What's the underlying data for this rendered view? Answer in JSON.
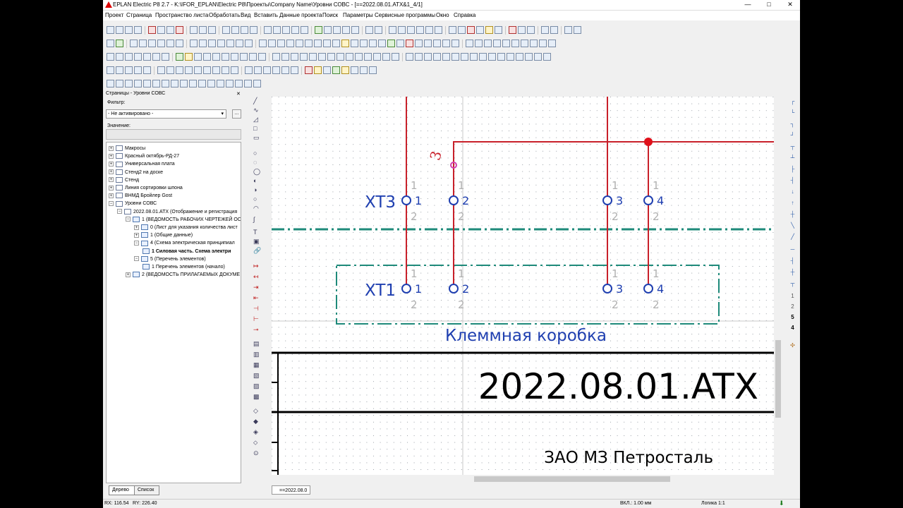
{
  "window": {
    "title": "EPLAN Electric P8 2.7 - K:\\IFOR_EPLAN\\Electric P8\\Проекты\\Company Name\\Уровни СОВС - [==2022.08.01.ATX&1_4/1]",
    "minimize": "—",
    "maximize": "□",
    "close": "✕"
  },
  "menu": [
    "Проект",
    "Страница",
    "Пространство листа",
    "Обработать",
    "Вид",
    "Вставить",
    "Данные проекта",
    "Поиск",
    "Параметры",
    "Сервисные программы",
    "Окно",
    "Справка"
  ],
  "left_panel": {
    "header": "Страницы - Уровни СОВС",
    "close": "✕",
    "filter_label": "Фильтр:",
    "filter_value": "- Не активировано -",
    "filter_button": "...",
    "value_label": "Значение:",
    "tree": [
      {
        "label": "Макросы",
        "level": 0,
        "expander": "+"
      },
      {
        "label": "Красный октябрь-РД-27",
        "level": 0,
        "expander": "+"
      },
      {
        "label": "Универсальная плата",
        "level": 0,
        "expander": "+"
      },
      {
        "label": "Стенд2 на доске",
        "level": 0,
        "expander": "+"
      },
      {
        "label": "Стенд",
        "level": 0,
        "expander": "+"
      },
      {
        "label": "Линия сортировки шпона",
        "level": 0,
        "expander": "+"
      },
      {
        "label": "ВНМД Бройлер Gost",
        "level": 0,
        "expander": "+"
      },
      {
        "label": "Уровни СОВС",
        "level": 0,
        "expander": "−"
      },
      {
        "label": "2022.08.01.ATX (Отображение и регистрация",
        "level": 1,
        "expander": "−"
      },
      {
        "label": "1 (ВЕДОМОСТЬ РАБОЧИХ ЧЕРТЕЖЕЙ ОС",
        "level": 2,
        "expander": "−"
      },
      {
        "label": "0 (Лист для указания количества лист",
        "level": 3,
        "expander": "+"
      },
      {
        "label": "1 (Общие данные)",
        "level": 3,
        "expander": "+"
      },
      {
        "label": "4 (Схема электрическая  принципиал",
        "level": 3,
        "expander": "−"
      },
      {
        "label": "1 Силовая часть. Схема электри",
        "level": 4,
        "expander": "",
        "selected": true
      },
      {
        "label": "5 (Перечень элементов)",
        "level": 3,
        "expander": "−"
      },
      {
        "label": "1 Перечень элементов (начало)",
        "level": 4,
        "expander": ""
      },
      {
        "label": "2 (ВЕДОМОСТЬ ПРИЛАГАЕМЫХ ДОКУМЕ",
        "level": 2,
        "expander": "+"
      }
    ],
    "tabs": [
      "Дерево",
      "Список"
    ]
  },
  "page_tab": "==2022.08.0",
  "right_numbers": [
    "1",
    "2",
    "5",
    "4"
  ],
  "schematic": {
    "wire_number": "3",
    "terminal_strips": [
      {
        "name": "XT3",
        "pins": [
          "1",
          "2",
          "3",
          "4"
        ]
      },
      {
        "name": "XT1",
        "pins": [
          "1",
          "2",
          "3",
          "4"
        ]
      }
    ],
    "upper_pin": "1",
    "lower_pin": "2",
    "box_label": "Клеммная коробка",
    "drawing_number": "2022.08.01.ATX",
    "company": "ЗАО МЗ Петросталь",
    "colors": {
      "wire": "#c8202a",
      "box": "#1e8a7a",
      "text": "#1f3fb0",
      "junction": "#e0101a",
      "pink": "#d040b0",
      "grey": "#b0b0b0"
    }
  },
  "status": {
    "rx": "RX: 116.54",
    "ry": "RY: 226.40",
    "grid": "ВКЛ.: 1.00 мм",
    "logic": "Логика 1:1"
  }
}
